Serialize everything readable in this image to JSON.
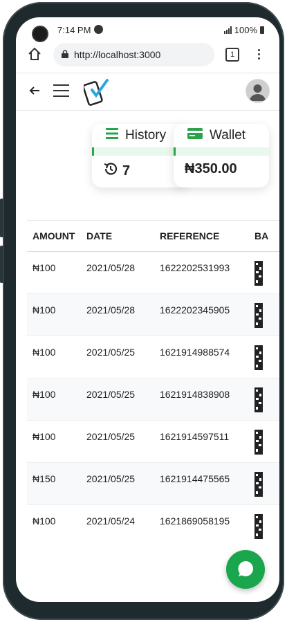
{
  "status": {
    "time": "7:14 PM",
    "battery": "100%"
  },
  "browser": {
    "url": "http://localhost:3000",
    "tab_count": "1"
  },
  "cards": {
    "history": {
      "label": "History",
      "value": "7"
    },
    "wallet": {
      "label": "Wallet",
      "value": "₦350.00"
    }
  },
  "table": {
    "headers": [
      "AMOUNT",
      "DATE",
      "REFERENCE",
      "BA"
    ],
    "rows": [
      {
        "amount": "₦100",
        "date": "2021/05/28",
        "reference": "1622202531993"
      },
      {
        "amount": "₦100",
        "date": "2021/05/28",
        "reference": "1622202345905"
      },
      {
        "amount": "₦100",
        "date": "2021/05/25",
        "reference": "1621914988574"
      },
      {
        "amount": "₦100",
        "date": "2021/05/25",
        "reference": "1621914838908"
      },
      {
        "amount": "₦100",
        "date": "2021/05/25",
        "reference": "1621914597511"
      },
      {
        "amount": "₦150",
        "date": "2021/05/25",
        "reference": "1621914475565"
      },
      {
        "amount": "₦100",
        "date": "2021/05/24",
        "reference": "1621869058195"
      }
    ]
  },
  "colors": {
    "accent": "#1aa64c",
    "band": "#e9f8ee"
  }
}
